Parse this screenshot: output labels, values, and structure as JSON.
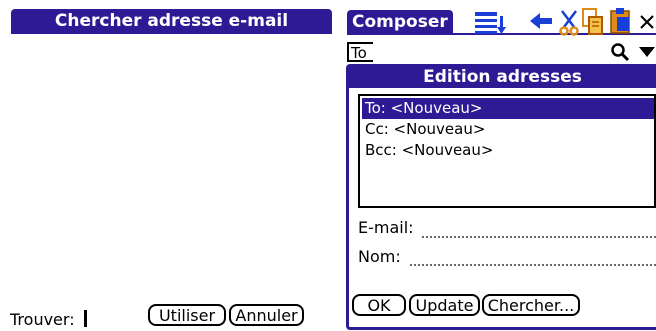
{
  "search_screen": {
    "title": "Chercher adresse e-mail",
    "find_label": "Trouver:",
    "use_button": "Utiliser",
    "cancel_button": "Annuler"
  },
  "composer": {
    "title": "Composer",
    "to_label": "To",
    "toolbar": [
      "list-icon",
      "arrow-left-icon",
      "cut-icon",
      "copy-icon",
      "paste-icon",
      "close-icon"
    ]
  },
  "dialog": {
    "title": "Edition adresses",
    "recipients": [
      {
        "label": "To: <Nouveau>",
        "selected": true
      },
      {
        "label": "Cc: <Nouveau>",
        "selected": false
      },
      {
        "label": "Bcc: <Nouveau>",
        "selected": false
      }
    ],
    "email_label": "E-mail:",
    "name_label": "Nom:",
    "ok_button": "OK",
    "update_button": "Update",
    "search_button": "Chercher..."
  },
  "colors": {
    "title_bar": "#2e1a94",
    "accent_blue": "#1a3fd6",
    "accent_orange": "#e08a1a"
  }
}
